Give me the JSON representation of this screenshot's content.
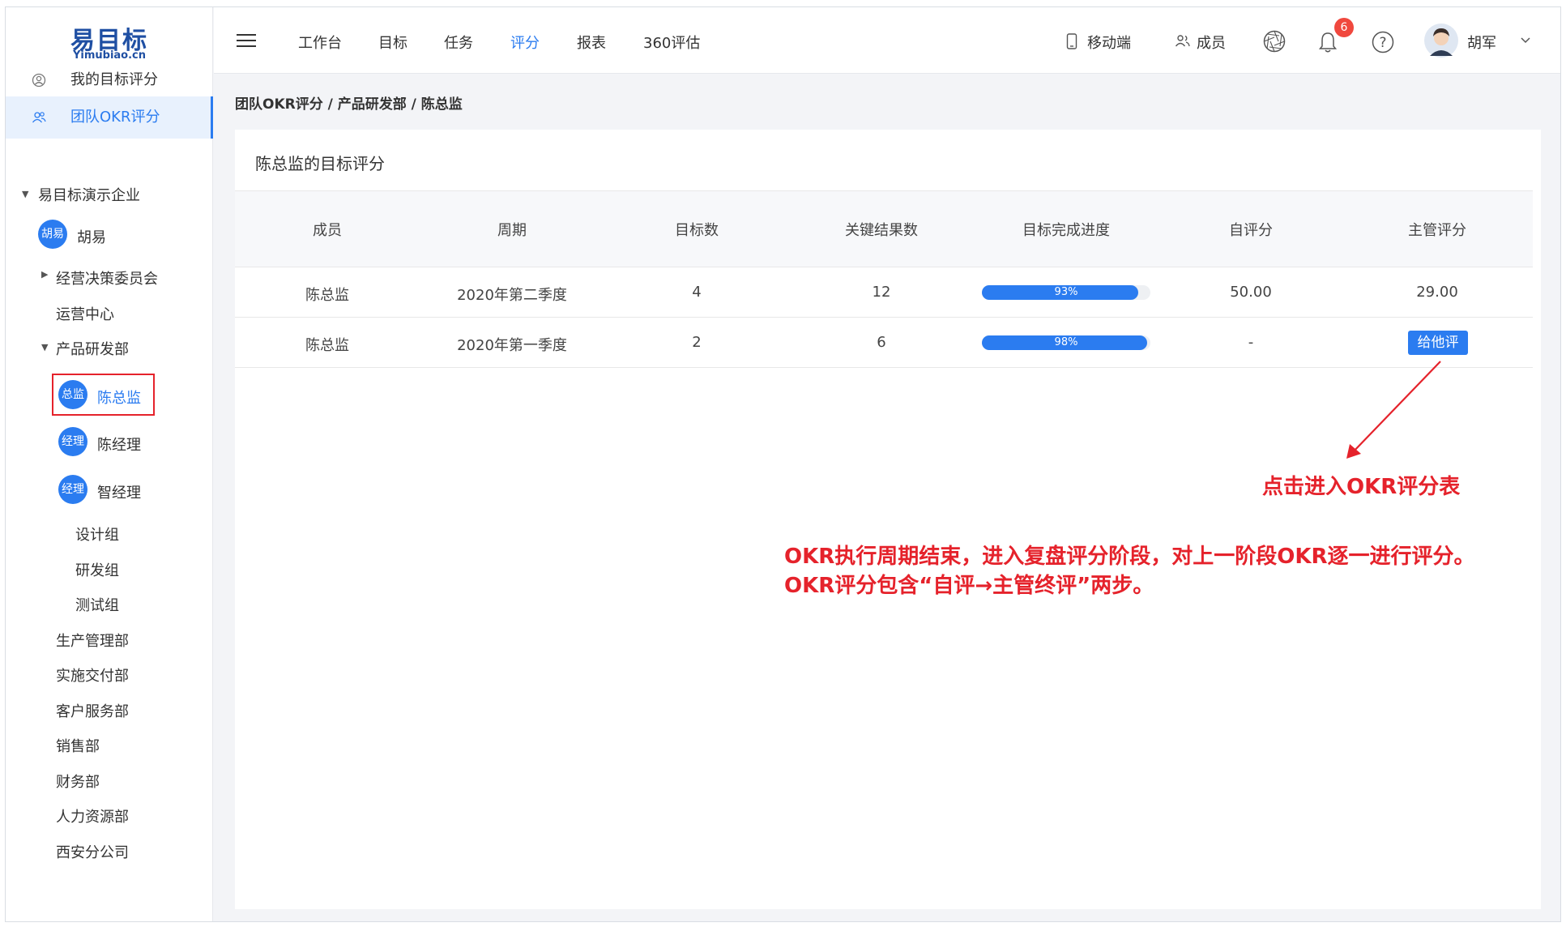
{
  "app": {
    "logo_cn": "易目标",
    "logo_en": "Yimubiao.cn"
  },
  "sidebar": {
    "menu": [
      {
        "label": "我的目标评分",
        "icon": "user-circle-icon"
      },
      {
        "label": "团队OKR评分",
        "icon": "team-icon"
      }
    ],
    "tree": {
      "company": "易目标演示企业",
      "leader": {
        "badge": "胡易",
        "name": "胡易"
      },
      "depts": [
        {
          "label": "经营决策委员会"
        },
        {
          "label": "运营中心"
        },
        {
          "label": "产品研发部"
        }
      ],
      "members": [
        {
          "badge": "总监",
          "name": "陈总监"
        },
        {
          "badge": "经理",
          "name": "陈经理"
        },
        {
          "badge": "经理",
          "name": "智经理"
        }
      ],
      "groups": [
        "设计组",
        "研发组",
        "测试组"
      ],
      "other_depts": [
        "生产管理部",
        "实施交付部",
        "客户服务部",
        "销售部",
        "财务部",
        "人力资源部",
        "西安分公司"
      ]
    }
  },
  "header": {
    "nav": [
      "工作台",
      "目标",
      "任务",
      "评分",
      "报表",
      "360评估"
    ],
    "active_nav": "评分",
    "mobile": "移动端",
    "members": "成员",
    "notifications": "6",
    "user": "胡军"
  },
  "breadcrumb": "团队OKR评分 / 产品研发部 / 陈总监",
  "card": {
    "title": "陈总监的目标评分",
    "columns": [
      "成员",
      "周期",
      "目标数",
      "关键结果数",
      "目标完成进度",
      "自评分",
      "主管评分"
    ],
    "rows": [
      {
        "member": "陈总监",
        "period": "2020年第二季度",
        "objectives": "4",
        "key_results": "12",
        "progress": 93,
        "progress_label": "93%",
        "self_score": "50.00",
        "manager_score": "29.00"
      },
      {
        "member": "陈总监",
        "period": "2020年第一季度",
        "objectives": "2",
        "key_results": "6",
        "progress": 98,
        "progress_label": "98%",
        "self_score": "-",
        "manager_action": "给他评"
      }
    ]
  },
  "annotations": {
    "arrow_label": "点击进入OKR评分表",
    "note_line1": "OKR执行周期结束，进入复盘评分阶段，对上一阶段OKR逐一进行评分。",
    "note_line2": "OKR评分包含“自评→主管终评”两步。"
  },
  "colors": {
    "accent": "#2b7cf0",
    "annotation": "#e5222b",
    "badge": "#f0483e"
  }
}
